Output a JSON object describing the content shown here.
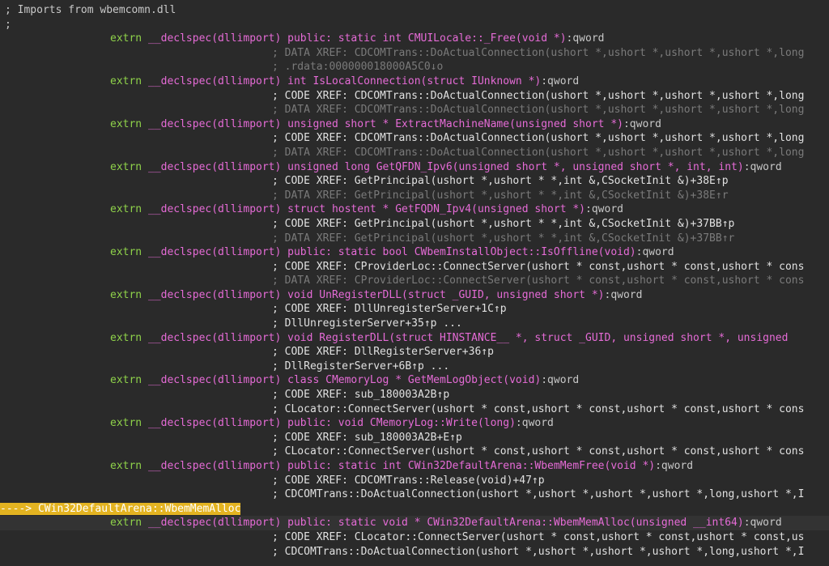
{
  "colors": {
    "background": "#2a2a2a",
    "highlight_line": "#333333",
    "extrn_keyword": "#8fd24a",
    "declaration": "#e56bd6",
    "code_xref": "#e0e0e0",
    "data_xref": "#7a7a7a",
    "position_marker": "#e3b321"
  },
  "lines": [
    {
      "kind": "comment",
      "text": "; Imports from wbemcomn.dll"
    },
    {
      "kind": "comment",
      "text": ";"
    },
    {
      "kind": "decl",
      "ind": "extrn ",
      "text": "__declspec(dllimport) public: static int CMUILocale::_Free(void *)",
      "suffix": ":qword"
    },
    {
      "kind": "dxref",
      "text": "; DATA XREF: CDCOMTrans::DoActualConnection(ushort *,ushort *,ushort *,ushort *,long"
    },
    {
      "kind": "dxref",
      "text": "; .rdata:000000018000A5C0↓o"
    },
    {
      "kind": "decl",
      "ind": "extrn ",
      "text": "__declspec(dllimport) int IsLocalConnection(struct IUnknown *)",
      "suffix": ":qword"
    },
    {
      "kind": "xref",
      "text": "; CODE XREF: CDCOMTrans::DoActualConnection(ushort *,ushort *,ushort *,ushort *,long"
    },
    {
      "kind": "dxref",
      "text": "; DATA XREF: CDCOMTrans::DoActualConnection(ushort *,ushort *,ushort *,ushort *,long"
    },
    {
      "kind": "decl",
      "ind": "extrn ",
      "text": "__declspec(dllimport) unsigned short * ExtractMachineName(unsigned short *)",
      "suffix": ":qword"
    },
    {
      "kind": "xref",
      "text": "; CODE XREF: CDCOMTrans::DoActualConnection(ushort *,ushort *,ushort *,ushort *,long"
    },
    {
      "kind": "dxref",
      "text": "; DATA XREF: CDCOMTrans::DoActualConnection(ushort *,ushort *,ushort *,ushort *,long"
    },
    {
      "kind": "decl",
      "ind": "extrn ",
      "text": "__declspec(dllimport) unsigned long GetQFDN_Ipv6(unsigned short *, unsigned short *, int, int)",
      "suffix": ":qword"
    },
    {
      "kind": "xref",
      "text": "; CODE XREF: GetPrincipal(ushort *,ushort * *,int &,CSocketInit &)+38E↑p"
    },
    {
      "kind": "dxref",
      "text": "; DATA XREF: GetPrincipal(ushort *,ushort * *,int &,CSocketInit &)+38E↑r"
    },
    {
      "kind": "decl",
      "ind": "extrn ",
      "text": "__declspec(dllimport) struct hostent * GetFQDN_Ipv4(unsigned short *)",
      "suffix": ":qword"
    },
    {
      "kind": "xref",
      "text": "; CODE XREF: GetPrincipal(ushort *,ushort * *,int &,CSocketInit &)+37BB↑p"
    },
    {
      "kind": "dxref",
      "text": "; DATA XREF: GetPrincipal(ushort *,ushort * *,int &,CSocketInit &)+37BB↑r"
    },
    {
      "kind": "decl",
      "ind": "extrn ",
      "text": "__declspec(dllimport) public: static bool CWbemInstallObject::IsOffline(void)",
      "suffix": ":qword"
    },
    {
      "kind": "xref",
      "text": "; CODE XREF: CProviderLoc::ConnectServer(ushort * const,ushort * const,ushort * cons"
    },
    {
      "kind": "dxref",
      "text": "; DATA XREF: CProviderLoc::ConnectServer(ushort * const,ushort * const,ushort * cons"
    },
    {
      "kind": "decl",
      "ind": "extrn ",
      "text": "__declspec(dllimport) void UnRegisterDLL(struct _GUID, unsigned short *)",
      "suffix": ":qword"
    },
    {
      "kind": "xref",
      "text": "; CODE XREF: DllUnregisterServer+1C↑p"
    },
    {
      "kind": "xref",
      "text": "; DllUnregisterServer+35↑p ..."
    },
    {
      "kind": "decl",
      "ind": "extrn ",
      "text": "__declspec(dllimport) void RegisterDLL(struct HINSTANCE__ *, struct _GUID, unsigned short *, unsigned",
      "suffix": ""
    },
    {
      "kind": "xref",
      "text": "; CODE XREF: DllRegisterServer+36↑p"
    },
    {
      "kind": "xref",
      "text": "; DllRegisterServer+6B↑p ..."
    },
    {
      "kind": "decl",
      "ind": "extrn ",
      "text": "__declspec(dllimport) class CMemoryLog * GetMemLogObject(void)",
      "suffix": ":qword"
    },
    {
      "kind": "xref",
      "text": "; CODE XREF: sub_180003A2B↑p"
    },
    {
      "kind": "xref",
      "text": "; CLocator::ConnectServer(ushort * const,ushort * const,ushort * const,ushort * cons"
    },
    {
      "kind": "decl",
      "ind": "extrn ",
      "text": "__declspec(dllimport) public: void CMemoryLog::Write(long)",
      "suffix": ":qword"
    },
    {
      "kind": "xref",
      "text": "; CODE XREF: sub_180003A2B+E↑p"
    },
    {
      "kind": "xref",
      "text": "; CLocator::ConnectServer(ushort * const,ushort * const,ushort * const,ushort * cons"
    },
    {
      "kind": "decl",
      "ind": "extrn ",
      "text": "__declspec(dllimport) public: static int CWin32DefaultArena::WbemMemFree(void *)",
      "suffix": ":qword"
    },
    {
      "kind": "xref",
      "text": "; CODE XREF: CDCOMTrans::Release(void)+47↑p"
    },
    {
      "kind": "xref",
      "text": "; CDCOMTrans::DoActualConnection(ushort *,ushort *,ushort *,ushort *,long,ushort *,I"
    },
    {
      "kind": "marker",
      "text": "----> CWin32DefaultArena::WbemMemAlloc"
    },
    {
      "kind": "decl",
      "ind": "extrn ",
      "text": "__declspec(dllimport) public: static void * CWin32DefaultArena::WbemMemAlloc(unsigned __int64)",
      "suffix": ":qword"
    },
    {
      "kind": "xref",
      "text": "; CODE XREF: CLocator::ConnectServer(ushort * const,ushort * const,ushort * const,us"
    },
    {
      "kind": "xref",
      "text": "; CDCOMTrans::DoActualConnection(ushort *,ushort *,ushort *,ushort *,long,ushort *,I"
    }
  ]
}
